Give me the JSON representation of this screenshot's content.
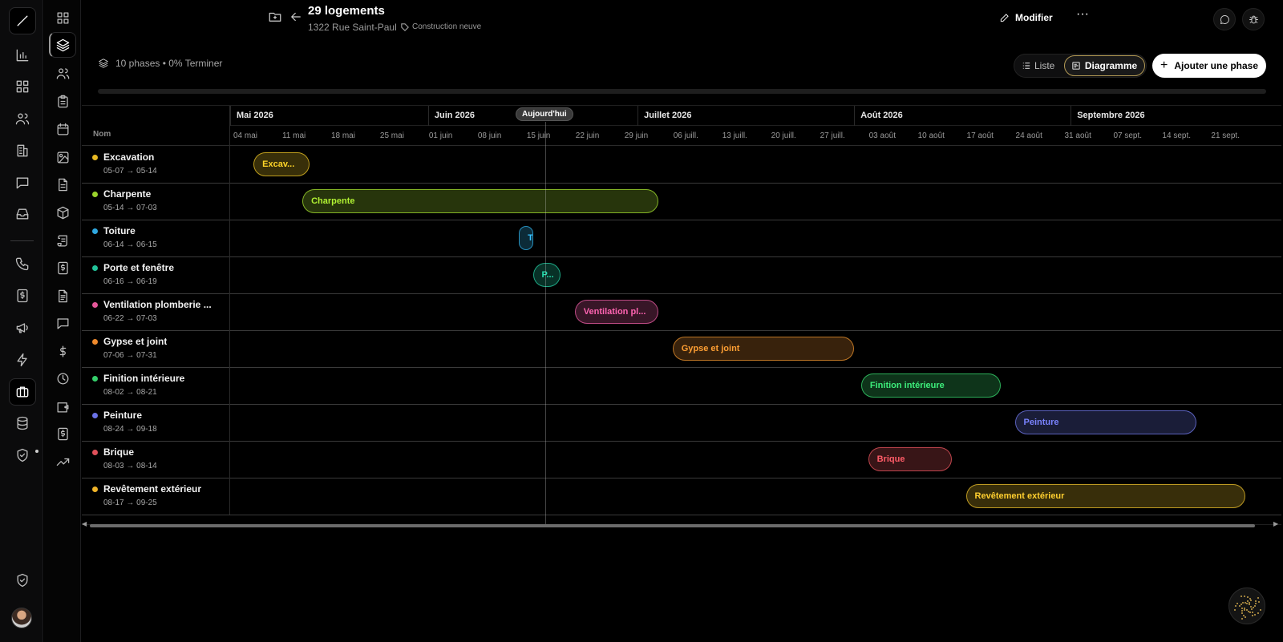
{
  "project": {
    "title": "29 logements",
    "address": "1322 Rue Saint-Paul",
    "tag": "Construction neuve"
  },
  "header": {
    "edit_label": "Modifier",
    "more_label": "···"
  },
  "summary": {
    "text": "10 phases • 0% Terminer"
  },
  "view_toggle": {
    "list_label": "Liste",
    "diagram_label": "Diagramme",
    "selected": "Diagramme"
  },
  "add_phase_label": "Ajouter une phase",
  "gantt": {
    "name_column_header": "Nom",
    "today_label": "Aujourd'hui",
    "months": [
      "Mai 2026",
      "Juin 2026",
      "Juillet 2026",
      "Août 2026",
      "Septembre 2026"
    ],
    "weeks": [
      "04 mai",
      "11 mai",
      "18 mai",
      "25 mai",
      "01 juin",
      "08 juin",
      "15 juin",
      "22 juin",
      "29 juin",
      "06 juill.",
      "13 juill.",
      "20 juill.",
      "27 juill.",
      "03 août",
      "10 août",
      "17 août",
      "24 août",
      "31 août",
      "07 sept.",
      "14 sept.",
      "21 sept."
    ],
    "phases": [
      {
        "name": "Excavation",
        "dates": "05-07 → 05-14",
        "bar_label": "Excav...",
        "color": "#e8b923"
      },
      {
        "name": "Charpente",
        "dates": "05-14 → 07-03",
        "bar_label": "Charpente",
        "color": "#9bd32c"
      },
      {
        "name": "Toiture",
        "dates": "06-14 → 06-15",
        "bar_label": "T...",
        "color": "#2fa8e0"
      },
      {
        "name": "Porte et fenêtre",
        "dates": "06-16 → 06-19",
        "bar_label": "P...",
        "color": "#22c39a"
      },
      {
        "name": "Ventilation plomberie ...",
        "dates": "06-22 → 07-03",
        "bar_label": "Ventilation pl...",
        "color": "#e5579a"
      },
      {
        "name": "Gypse et joint",
        "dates": "07-06 → 07-31",
        "bar_label": "Gypse et joint",
        "color": "#f08a2c"
      },
      {
        "name": "Finition intérieure",
        "dates": "08-02 → 08-21",
        "bar_label": "Finition intérieure",
        "color": "#35cf6b"
      },
      {
        "name": "Peinture",
        "dates": "08-24 → 09-18",
        "bar_label": "Peinture",
        "color": "#6a72e8"
      },
      {
        "name": "Brique",
        "dates": "08-03 → 08-14",
        "bar_label": "Brique",
        "color": "#e0505a"
      },
      {
        "name": "Revêtement extérieur",
        "dates": "08-17 → 09-25",
        "bar_label": "Revêtement extérieur",
        "color": "#f0b429"
      }
    ]
  },
  "icons": {
    "rail": [
      "logo-slash-icon",
      "bar-chart-icon",
      "grid-icon",
      "users-icon",
      "building-icon",
      "message-icon",
      "inbox-icon",
      "phone-icon",
      "dollar-receipt-icon",
      "megaphone-icon",
      "lightning-icon",
      "briefcase-icon",
      "database-icon",
      "shield-check-icon",
      "shield-check-icon"
    ],
    "subrail": [
      "grid-icon",
      "layers-icon",
      "users-icon",
      "clipboard-icon",
      "calendar-icon",
      "image-icon",
      "file-icon",
      "package-icon",
      "scroll-icon",
      "dollar-receipt-icon",
      "file-text-icon",
      "message-icon",
      "dollar-icon",
      "clock-icon",
      "wallet-icon",
      "dollar-receipt-icon",
      "trending-up-icon"
    ]
  }
}
